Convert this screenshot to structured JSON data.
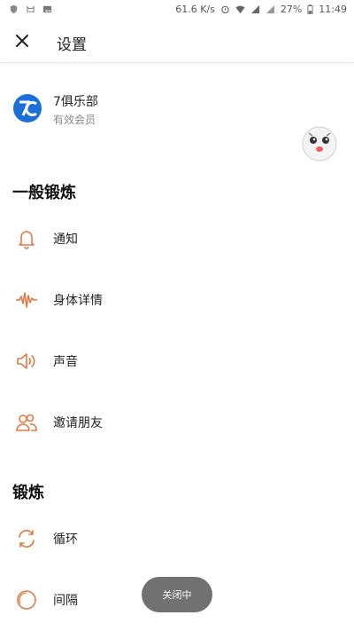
{
  "status_bar": {
    "speed": "61.6 K/s",
    "battery": "27%",
    "time": "11:49",
    "icons": [
      "shield-icon",
      "cat-icon",
      "image-icon",
      "alarm-icon",
      "wifi-icon",
      "signal-icon",
      "signal-icon",
      "battery-icon"
    ]
  },
  "header": {
    "title": "设置",
    "close_icon": "close-icon"
  },
  "club": {
    "name": "7俱乐部",
    "status": "有效会员",
    "logo": "7c-logo"
  },
  "sections": {
    "general": {
      "title": "一般锻炼",
      "items": [
        {
          "label": "通知",
          "icon": "bell-icon"
        },
        {
          "label": "身体详情",
          "icon": "waveform-icon"
        },
        {
          "label": "声音",
          "icon": "speaker-icon"
        },
        {
          "label": "邀请朋友",
          "icon": "friends-icon"
        }
      ]
    },
    "workout": {
      "title": "锻炼",
      "items": [
        {
          "label": "循环",
          "icon": "loop-icon"
        },
        {
          "label": "间隔",
          "icon": "interval-icon"
        }
      ]
    }
  },
  "toast": {
    "text": "关闭中"
  },
  "colors": {
    "accent": "#e07a45",
    "logo_blue": "#1b6fd6"
  }
}
